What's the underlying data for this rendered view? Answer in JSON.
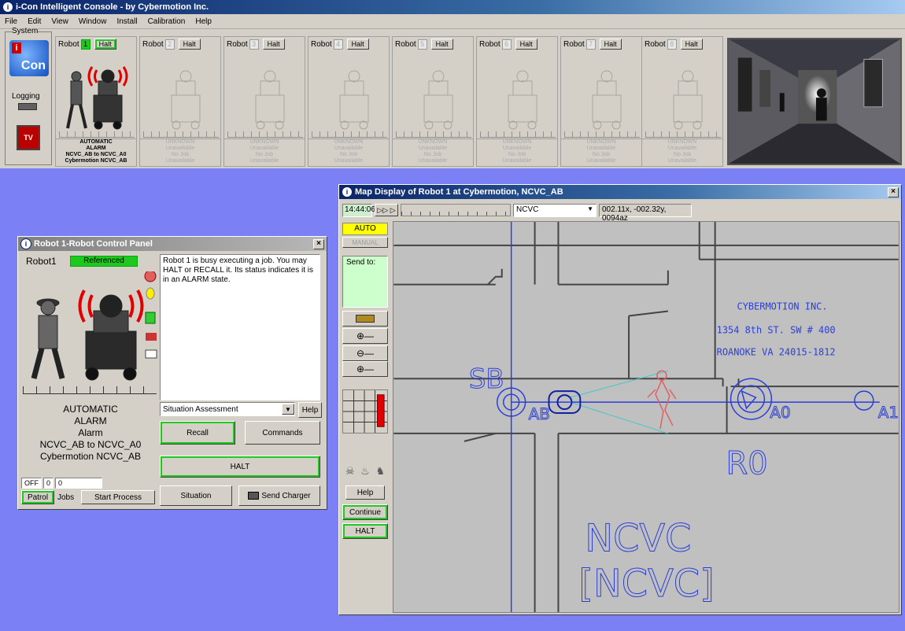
{
  "console": {
    "title": "i-Con Intelligent Console - by Cybermotion Inc.",
    "menu": [
      "File",
      "Edit",
      "View",
      "Window",
      "Install",
      "Calibration",
      "Help"
    ],
    "system_label": "System",
    "logo_text": "Con",
    "logo_badge": "i",
    "logging_label": "Logging",
    "tv_label": "TV"
  },
  "robots": [
    {
      "label": "Robot",
      "num": "1",
      "halt": "Halt",
      "status": [
        "AUTOMATIC",
        "ALARM",
        "NCVC_AB to NCVC_A0",
        "Cybermotion NCVC_AB"
      ]
    },
    {
      "label": "Robot",
      "num": "2",
      "halt": "Halt",
      "status": [
        "UNKNOWN",
        "Unavailable",
        "No Job",
        "Unavailable"
      ]
    },
    {
      "label": "Robot",
      "num": "3",
      "halt": "Halt",
      "status": [
        "UNKNOWN",
        "Unavailable",
        "No Job",
        "Unavailable"
      ]
    },
    {
      "label": "Robot",
      "num": "4",
      "halt": "Halt",
      "status": [
        "UNKNOWN",
        "Unavailable",
        "No Job",
        "Unavailable"
      ]
    },
    {
      "label": "Robot",
      "num": "5",
      "halt": "Halt",
      "status": [
        "UNKNOWN",
        "Unavailable",
        "No Job",
        "Unavailable"
      ]
    },
    {
      "label": "Robot",
      "num": "6",
      "halt": "Halt",
      "status": [
        "UNKNOWN",
        "Unavailable",
        "No Job",
        "Unavailable"
      ]
    },
    {
      "label": "Robot",
      "num": "7",
      "halt": "Halt",
      "status": [
        "UNKNOWN",
        "Unavailable",
        "No Job",
        "Unavailable"
      ]
    },
    {
      "label": "Robot",
      "num": "8",
      "halt": "Halt",
      "status": [
        "UNKNOWN",
        "Unavailable",
        "No Job",
        "Unavailable"
      ]
    }
  ],
  "rcp": {
    "title": "Robot 1-Robot Control Panel",
    "robot_label": "Robot1",
    "referenced": "Referenced",
    "message": "Robot 1 is busy executing a job. You may HALT or RECALL it. Its status indicates it is in an ALARM state.",
    "status_lines": [
      "AUTOMATIC",
      "ALARM",
      "Alarm",
      "NCVC_AB to NCVC_A0",
      "Cybermotion NCVC_AB"
    ],
    "situation_select": "Situation Assessment",
    "help": "Help",
    "recall": "Recall",
    "commands": "Commands",
    "halt": "HALT",
    "situation": "Situation",
    "send_charger": "Send Charger",
    "counter_off": "OFF",
    "counter_a": "0",
    "counter_b": "0",
    "patrol": "Patrol",
    "jobs": "Jobs",
    "start_process": "Start Process"
  },
  "map": {
    "title": "Map Display of Robot 1 at Cybermotion, NCVC_AB",
    "time": "14:44:06",
    "play": "▷▷ ▷",
    "site": "NCVC",
    "coords": "002.11x, -002.32y, 0094az",
    "auto": "AUTO",
    "manual": "MANUAL",
    "send_to": "Send to:",
    "help": "Help",
    "continue": "Continue",
    "halt": "HALT",
    "labels": {
      "company": "CYBERMOTION INC.",
      "address1": "1354 8th ST. SW # 400",
      "address2": "ROANOKE VA 24015-1812",
      "sb": "SB",
      "ab": "AB",
      "a0": "A0",
      "a1": "A1",
      "r0": "R0",
      "ncvc": "NCVC",
      "ncvc_bracket": "[NCVC]"
    }
  },
  "colors": {
    "desktop": "#7b80f4",
    "active_green": "#1ec81e",
    "map_blue": "#2b3fd6",
    "intruder_red": "#e06060",
    "auto_yellow": "#ffff00"
  }
}
